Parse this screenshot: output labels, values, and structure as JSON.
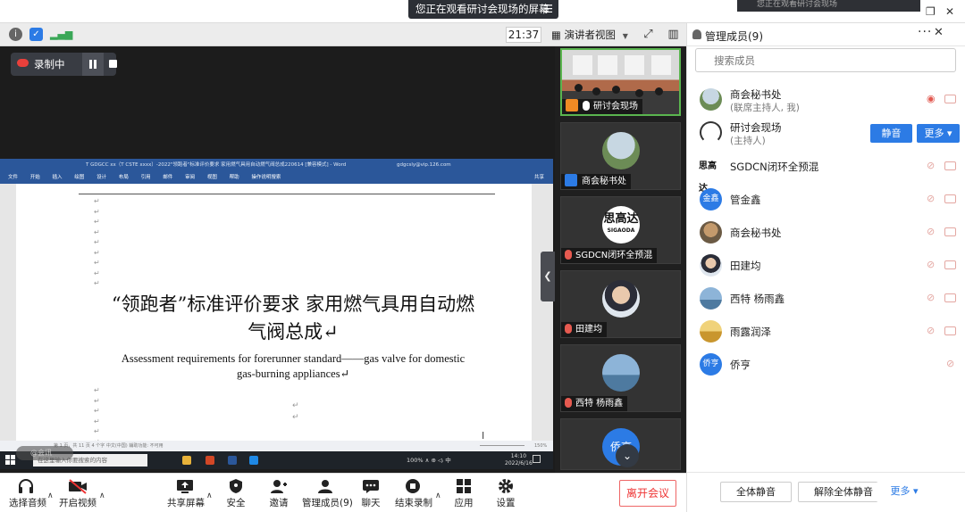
{
  "title_bar": {
    "watch_label": "您正在观看研讨会现场的屏幕",
    "menu_glyph": "☰",
    "top_banner": "您正在观看研讨会现场"
  },
  "toolbar": {
    "time": "21:37",
    "view_label": "演讲者视图"
  },
  "recording": {
    "label": "录制中"
  },
  "word": {
    "title": "T GDGCC xx（T CSTE xxxx）-2022\"领跑者\"标准评价要求 家用燃气具用自动燃气阀总成220614 [兼容模式] - Word",
    "account": "gdgcsly@vip.126.com",
    "menu": [
      "文件",
      "开始",
      "插入",
      "绘图",
      "设计",
      "布局",
      "引用",
      "邮件",
      "审阅",
      "视图",
      "帮助",
      "操作说明搜索"
    ],
    "share_label": "共享",
    "title_line1": "“领跑者”标准评价要求 家用燃气具用自动燃",
    "title_line2": "气阀总成↵",
    "subtitle_line1": "Assessment requirements for forerunner standard——gas valve for domestic",
    "subtitle_line2": "gas-burning appliances↵",
    "status_left": "第 1 页，共 11 页   4 个字   中文(中国)   辅助功能: 不可用",
    "zoom": "150%",
    "taskbar_search": "在这里输入你要搜索的内容",
    "tray": "100%  ∧ ⊕ ◁ᵢ 中",
    "sys_time": "14:10",
    "sys_date": "2022/6/16",
    "ghost_label": "@会讯",
    "para_mark": "↵"
  },
  "strip": {
    "tiles": [
      {
        "name": "研讨会现场"
      },
      {
        "name": "商会秘书处"
      },
      {
        "name": "SGDCN闭环全预混",
        "logo_main": "思高达",
        "logo_sub": "SIGAODA"
      },
      {
        "name": "田建均"
      },
      {
        "name": "西特 杨雨鑫"
      }
    ],
    "last_avatar_text": "侨亨"
  },
  "panel": {
    "title": "管理成员(9)",
    "more_glyph": "···",
    "close_glyph": "✕",
    "search_placeholder": "搜索成员",
    "mute_btn": "静音",
    "more_btn": "更多 ▾",
    "members": [
      {
        "name": "商会秘书处",
        "sub": "(联席主持人, 我)"
      },
      {
        "name": "研讨会现场",
        "sub": "(主持人)"
      },
      {
        "name": "SGDCN闭环全预混",
        "logo": "思高达"
      },
      {
        "name": "管金鑫",
        "avatar_text": "金鑫"
      },
      {
        "name": "商会秘书处"
      },
      {
        "name": "田建均"
      },
      {
        "name": "西特 杨雨鑫"
      },
      {
        "name": "雨露润泽"
      },
      {
        "name": "侨亨",
        "avatar_text": "侨亨"
      }
    ],
    "footer": {
      "mute_all": "全体静音",
      "unmute_all": "解除全体静音",
      "more": "更多 ▾"
    }
  },
  "controls": {
    "audio": "选择音频",
    "video": "开启视频",
    "share": "共享屏幕",
    "security": "安全",
    "invite": "邀请",
    "members": "管理成员(9)",
    "chat": "聊天",
    "record": "结束录制",
    "apps": "应用",
    "settings": "设置",
    "leave": "离开会议"
  },
  "colors": {
    "accent": "#2c7be5",
    "leave_red": "#e33333",
    "word_blue": "#2b579a",
    "active_tile": "#5ab54f"
  }
}
